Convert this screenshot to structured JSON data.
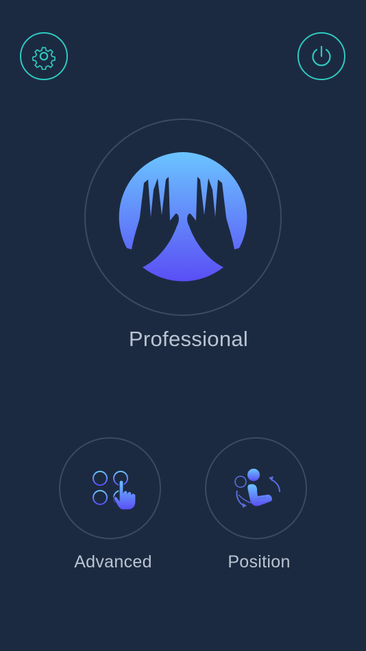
{
  "app": {
    "colors": {
      "background": "#1c2a41",
      "accent_teal": "#2fc9c0",
      "ring": "#3b4a64",
      "gradient_top": "#6bc4ff",
      "gradient_bottom": "#5a4ef5",
      "label": "#b9c3d2"
    }
  },
  "header": {
    "settings_icon": "gear-icon",
    "power_icon": "power-icon"
  },
  "modes": {
    "main": {
      "label": "Professional",
      "icon": "hands-massage-icon"
    },
    "advanced": {
      "label": "Advanced",
      "icon": "grid-touch-icon"
    },
    "position": {
      "label": "Position",
      "icon": "recline-seat-icon"
    }
  }
}
